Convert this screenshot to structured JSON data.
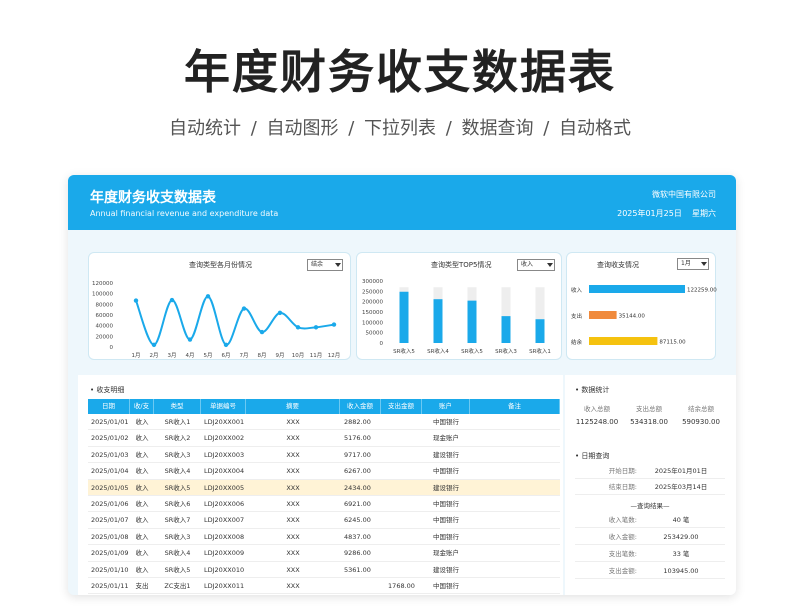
{
  "hero": {
    "title": "年度财务收支数据表",
    "features": "自动统计 / 自动图形 / 下拉列表 / 数据查询 / 自动格式"
  },
  "header": {
    "title": "年度财务收支数据表",
    "subtitle_en": "Annual financial revenue and expenditure data",
    "company": "微软中国有限公司",
    "date": "2025年01月25日",
    "weekday": "星期六"
  },
  "colors": {
    "accent": "#1aa9ea",
    "expense": "#f08a3c",
    "balance": "#f5c20f",
    "highlight": "#fff3d6"
  },
  "charts": {
    "monthly": {
      "title": "查询类型各月份情况",
      "dropdown": "结余"
    },
    "top5": {
      "title": "查询类型TOP5情况",
      "dropdown": "收入"
    },
    "summary": {
      "title": "查询收支情况",
      "dropdown": "1月"
    }
  },
  "chart_data": [
    {
      "type": "line",
      "title": "查询类型各月份情况",
      "categories": [
        "1月",
        "2月",
        "3月",
        "4月",
        "5月",
        "6月",
        "7月",
        "8月",
        "9月",
        "10月",
        "11月",
        "12月"
      ],
      "values": [
        87000,
        4000,
        88000,
        14000,
        95000,
        4000,
        72000,
        28000,
        64000,
        37000,
        37000,
        42000
      ],
      "yticks": [
        "120000",
        "100000",
        "80000",
        "60000",
        "40000",
        "20000",
        "0"
      ],
      "ylim": [
        0,
        120000
      ],
      "grid": false
    },
    {
      "type": "bar",
      "title": "查询类型TOP5情况",
      "categories": [
        "SR收入5",
        "SR收入4",
        "SR收入5",
        "SR收入3",
        "SR收入1"
      ],
      "values": [
        248000,
        212000,
        205000,
        130000,
        115000
      ],
      "max": 270000,
      "yticks": [
        "300000",
        "250000",
        "200000",
        "150000",
        "100000",
        "50000",
        "0"
      ],
      "ylim": [
        0,
        300000
      ]
    },
    {
      "type": "bar",
      "orientation": "horizontal",
      "title": "查询收支情况",
      "categories": [
        "收入",
        "支出",
        "结余"
      ],
      "values": [
        122259,
        35144,
        87115
      ],
      "labels": [
        "122259.00",
        "35144.00",
        "87115.00"
      ]
    }
  ],
  "detail": {
    "title": "收支明细",
    "headers": [
      "日期",
      "收/支",
      "类型",
      "单据编号",
      "摘要",
      "收入金额",
      "支出金额",
      "账户",
      "备注"
    ],
    "rows": [
      [
        "2025/01/01",
        "收入",
        "SR收入1",
        "LDJ20XX001",
        "XXX",
        "2882.00",
        "",
        "中国银行",
        ""
      ],
      [
        "2025/01/02",
        "收入",
        "SR收入2",
        "LDJ20XX002",
        "XXX",
        "5176.00",
        "",
        "现金账户",
        ""
      ],
      [
        "2025/01/03",
        "收入",
        "SR收入3",
        "LDJ20XX003",
        "XXX",
        "9717.00",
        "",
        "建设银行",
        ""
      ],
      [
        "2025/01/04",
        "收入",
        "SR收入4",
        "LDJ20XX004",
        "XXX",
        "6267.00",
        "",
        "中国银行",
        ""
      ],
      [
        "2025/01/05",
        "收入",
        "SR收入5",
        "LDJ20XX005",
        "XXX",
        "2434.00",
        "",
        "建设银行",
        ""
      ],
      [
        "2025/01/06",
        "收入",
        "SR收入6",
        "LDJ20XX006",
        "XXX",
        "6921.00",
        "",
        "中国银行",
        ""
      ],
      [
        "2025/01/07",
        "收入",
        "SR收入7",
        "LDJ20XX007",
        "XXX",
        "6245.00",
        "",
        "中国银行",
        ""
      ],
      [
        "2025/01/08",
        "收入",
        "SR收入3",
        "LDJ20XX008",
        "XXX",
        "4837.00",
        "",
        "中国银行",
        ""
      ],
      [
        "2025/01/09",
        "收入",
        "SR收入4",
        "LDJ20XX009",
        "XXX",
        "9286.00",
        "",
        "现金账户",
        ""
      ],
      [
        "2025/01/10",
        "收入",
        "SR收入5",
        "LDJ20XX010",
        "XXX",
        "5361.00",
        "",
        "建设银行",
        ""
      ],
      [
        "2025/01/11",
        "支出",
        "ZC支出1",
        "LDJ20XX011",
        "XXX",
        "",
        "1768.00",
        "中国银行",
        ""
      ]
    ]
  },
  "stats": {
    "title": "数据统计",
    "labels": [
      "收入总额",
      "支出总额",
      "结余总额"
    ],
    "values": [
      "1125248.00",
      "534318.00",
      "590930.00"
    ]
  },
  "query": {
    "title": "日期查询",
    "start_label": "开始日期:",
    "start_value": "2025年01月01日",
    "end_label": "结束日期:",
    "end_value": "2025年03月14日",
    "result_title": "—查询结果—",
    "results": [
      {
        "label": "收入笔数:",
        "value": "40 笔"
      },
      {
        "label": "收入金额:",
        "value": "253429.00"
      },
      {
        "label": "支出笔数:",
        "value": "33 笔"
      },
      {
        "label": "支出金额:",
        "value": "103945.00"
      }
    ]
  }
}
